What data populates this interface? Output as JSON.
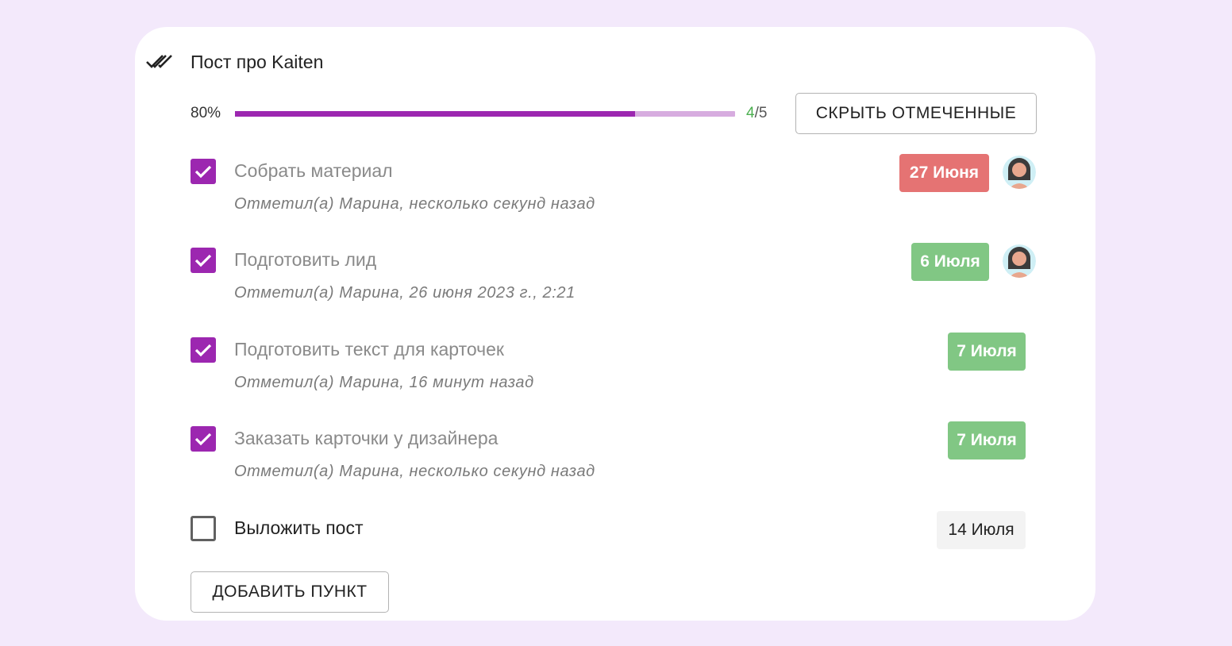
{
  "checklist": {
    "title": "Пост про Kaiten",
    "icon": "double-check-icon",
    "progress": {
      "percent_label": "80%",
      "fraction": 0.8,
      "done": "4",
      "separator": "/",
      "total": "5"
    },
    "hide_checked_label": "СКРЫТЬ ОТМЕЧЕННЫЕ",
    "add_item_label": "ДОБАВИТЬ ПУНКТ",
    "items": [
      {
        "text": "Собрать материал",
        "checked": true,
        "meta": "Отметил(а) Марина, несколько секунд назад",
        "date": "27 Июня",
        "date_color": "#e57373",
        "has_avatar": true
      },
      {
        "text": "Подготовить лид",
        "checked": true,
        "meta": "Отметил(а) Марина, 26 июня 2023 г., 2:21",
        "date": "6 Июля",
        "date_color": "#81c784",
        "has_avatar": true
      },
      {
        "text": "Подготовить текст для карточек",
        "checked": true,
        "meta": "Отметил(а) Марина, 16 минут назад",
        "date": "7 Июля",
        "date_color": "#81c784",
        "has_avatar": false
      },
      {
        "text": "Заказать карточки у дизайнера",
        "checked": true,
        "meta": "Отметил(а) Марина, несколько секунд назад",
        "date": "7 Июля",
        "date_color": "#81c784",
        "has_avatar": false
      },
      {
        "text": "Выложить пост",
        "checked": false,
        "meta": "",
        "date": "14 Июля",
        "date_color": "#f5f5f5",
        "has_avatar": false
      }
    ]
  },
  "colors": {
    "accent": "#9c27b0",
    "accent_light": "#d7acdf",
    "background": "#f3e9fb",
    "overdue": "#e57373",
    "upcoming": "#81c784",
    "done_count": "#4caf50"
  }
}
